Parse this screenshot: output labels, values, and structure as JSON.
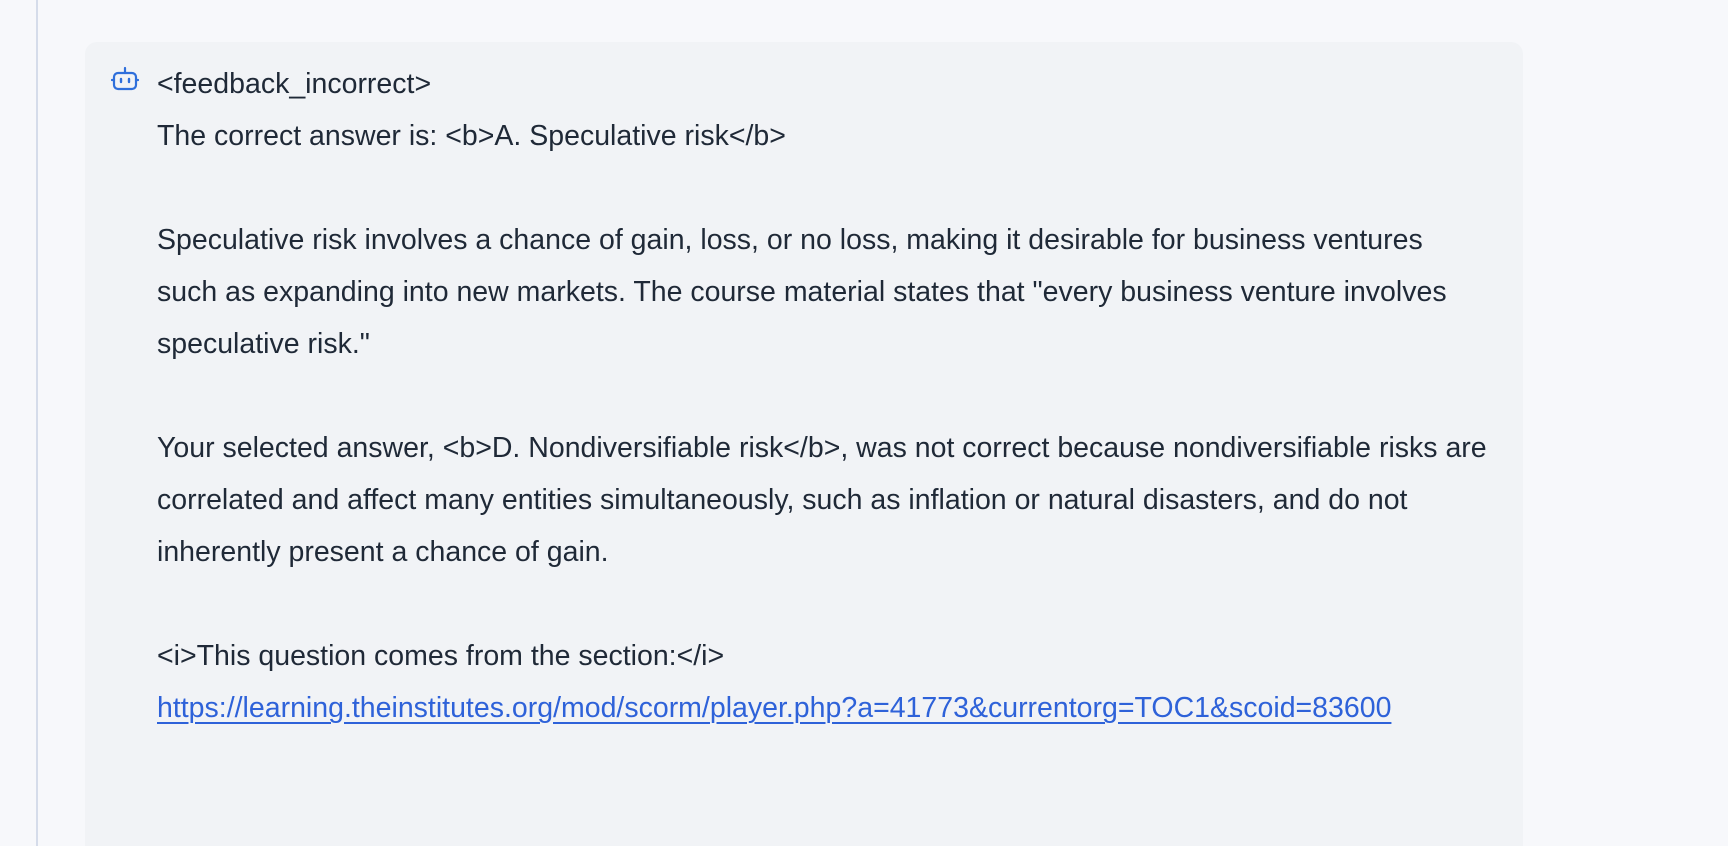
{
  "message": {
    "icon": "bot-icon",
    "lines": {
      "tag": "<feedback_incorrect>",
      "correct_answer": "The correct answer is: <b>A. Speculative risk</b>",
      "explanation": "Speculative risk involves a chance of gain, loss, or no loss, making it desirable for business ventures such as expanding into new markets. The course material states that \"every business venture involves speculative risk.\"",
      "selected_answer_feedback": "Your selected answer, <b>D. Nondiversifiable risk</b>, was not correct because nondiversifiable risks are correlated and affect many entities simultaneously, such as inflation or natural disasters, and do not inherently present a chance of gain.",
      "section_intro": "<i>This question comes from the section:</i>",
      "section_link": "https://learning.theinstitutes.org/mod/scorm/player.php?a=41773&currentorg=TOC1&scoid=83600"
    }
  },
  "colors": {
    "page_background": "#f7f8fb",
    "bubble_background": "#f1f3f6",
    "text": "#1f2937",
    "link": "#2e62d9",
    "icon": "#2f6fdb"
  }
}
